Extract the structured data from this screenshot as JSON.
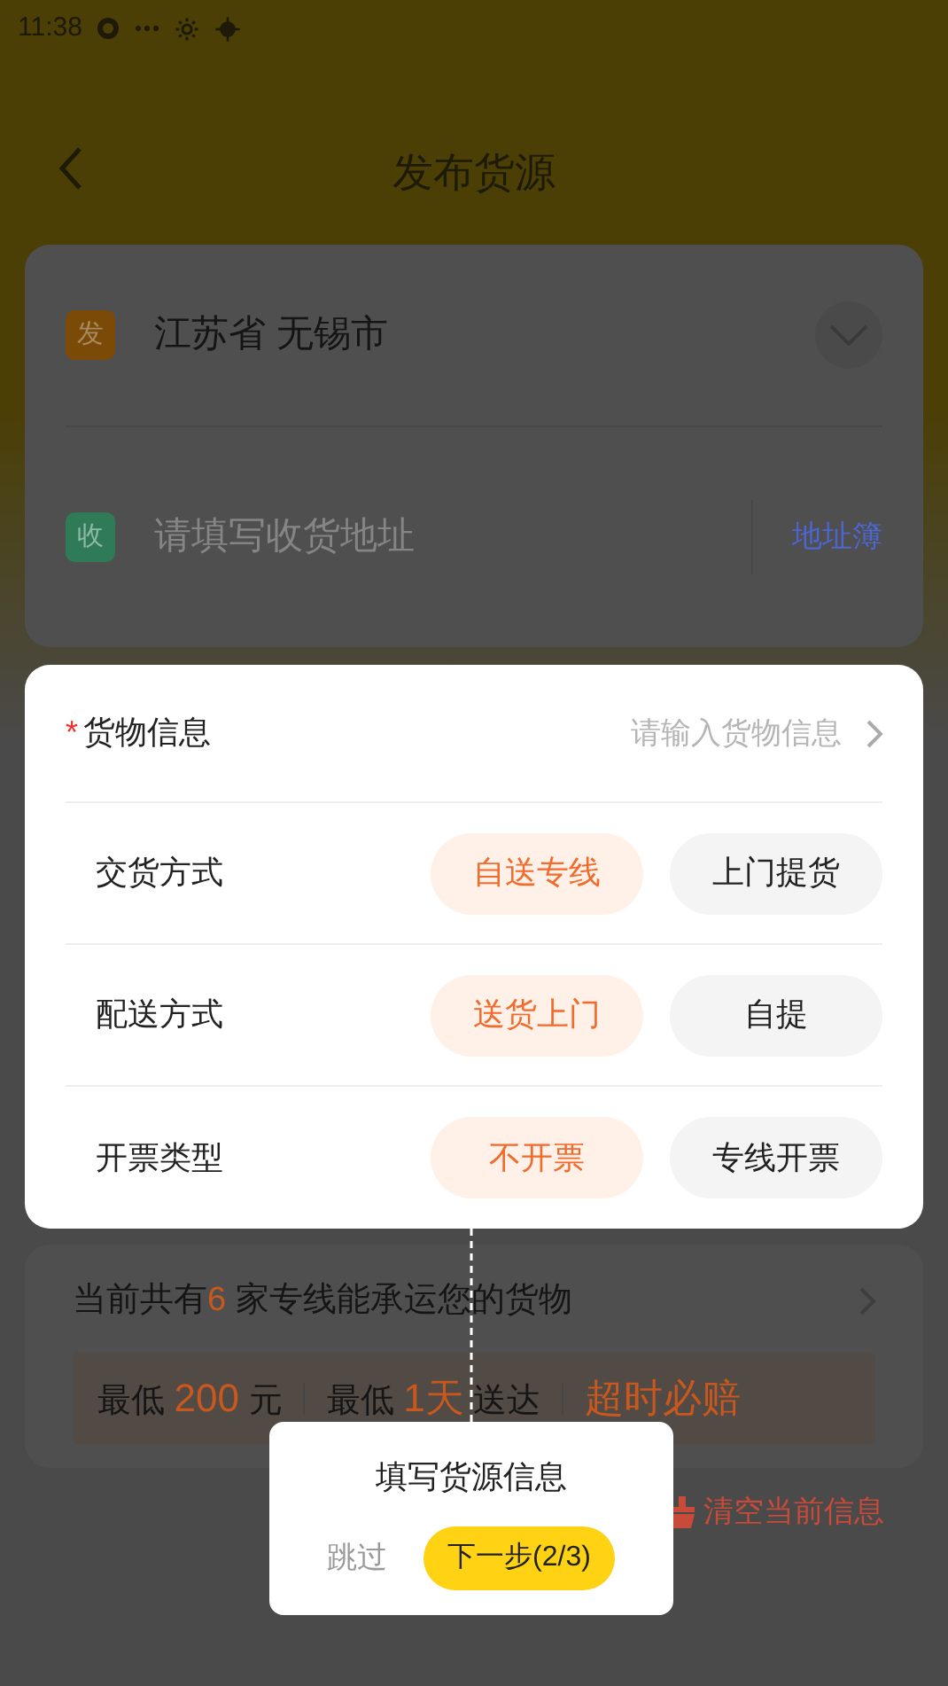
{
  "status_bar": {
    "time": "11:38"
  },
  "header": {
    "title": "发布货源"
  },
  "sender": {
    "badge": "发",
    "value": "江苏省 无锡市"
  },
  "receiver": {
    "badge": "收",
    "placeholder": "请填写收货地址",
    "address_book": "地址簿"
  },
  "cargo_info": {
    "required": true,
    "required_mark": "*",
    "label": "货物信息",
    "placeholder": "请输入货物信息"
  },
  "option_rows": [
    {
      "label": "交货方式",
      "choices": [
        {
          "label": "自送专线",
          "selected": true
        },
        {
          "label": "上门提货",
          "selected": false
        }
      ]
    },
    {
      "label": "配送方式",
      "choices": [
        {
          "label": "送货上门",
          "selected": true
        },
        {
          "label": "自提",
          "selected": false
        }
      ]
    },
    {
      "label": "开票类型",
      "choices": [
        {
          "label": "不开票",
          "selected": true
        },
        {
          "label": "专线开票",
          "selected": false
        }
      ]
    }
  ],
  "carriers": {
    "prefix": "当前共有",
    "count": "6",
    "suffix": "家专线能承运您的货物",
    "stats": [
      {
        "label": "最低",
        "value": "200",
        "unit": "元"
      },
      {
        "label": "最低",
        "value": "1天",
        "unit": "送达"
      }
    ],
    "guarantee": "超时必赔"
  },
  "clear_button": "清空当前信息",
  "tour": {
    "title": "填写货源信息",
    "skip": "跳过",
    "next": "下一步(2/3)"
  }
}
